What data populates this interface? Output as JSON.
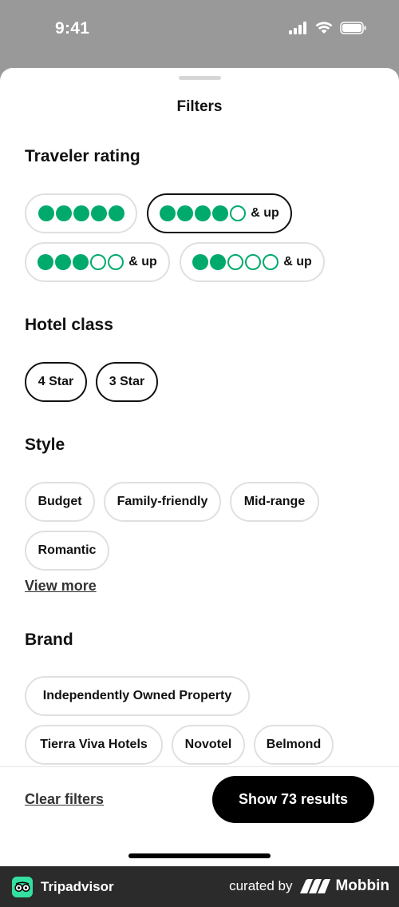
{
  "status_bar": {
    "time": "9:41"
  },
  "sheet": {
    "title": "Filters"
  },
  "traveler_rating": {
    "title": "Traveler rating",
    "options": [
      {
        "filled": 5,
        "suffix": "",
        "selected": false
      },
      {
        "filled": 4,
        "suffix": "& up",
        "selected": true
      },
      {
        "filled": 3,
        "suffix": "& up",
        "selected": false
      },
      {
        "filled": 2,
        "suffix": "& up",
        "selected": false
      }
    ]
  },
  "hotel_class": {
    "title": "Hotel class",
    "options": [
      "4 Star",
      "3 Star"
    ]
  },
  "style": {
    "title": "Style",
    "options": [
      "Budget",
      "Family-friendly",
      "Mid-range",
      "Romantic"
    ],
    "view_more": "View more"
  },
  "brand": {
    "title": "Brand",
    "options": [
      "Independently Owned Property",
      "Tierra Viva Hotels",
      "Novotel",
      "Belmond"
    ]
  },
  "actions": {
    "clear": "Clear filters",
    "show": "Show 73 results"
  },
  "footer": {
    "brand": "Tripadvisor",
    "curated_by": "curated by",
    "mobbin": "Mobbin"
  },
  "colors": {
    "rating_green": "#00aa6c",
    "primary_button": "#000000",
    "tripadvisor_green": "#34e0a1"
  }
}
